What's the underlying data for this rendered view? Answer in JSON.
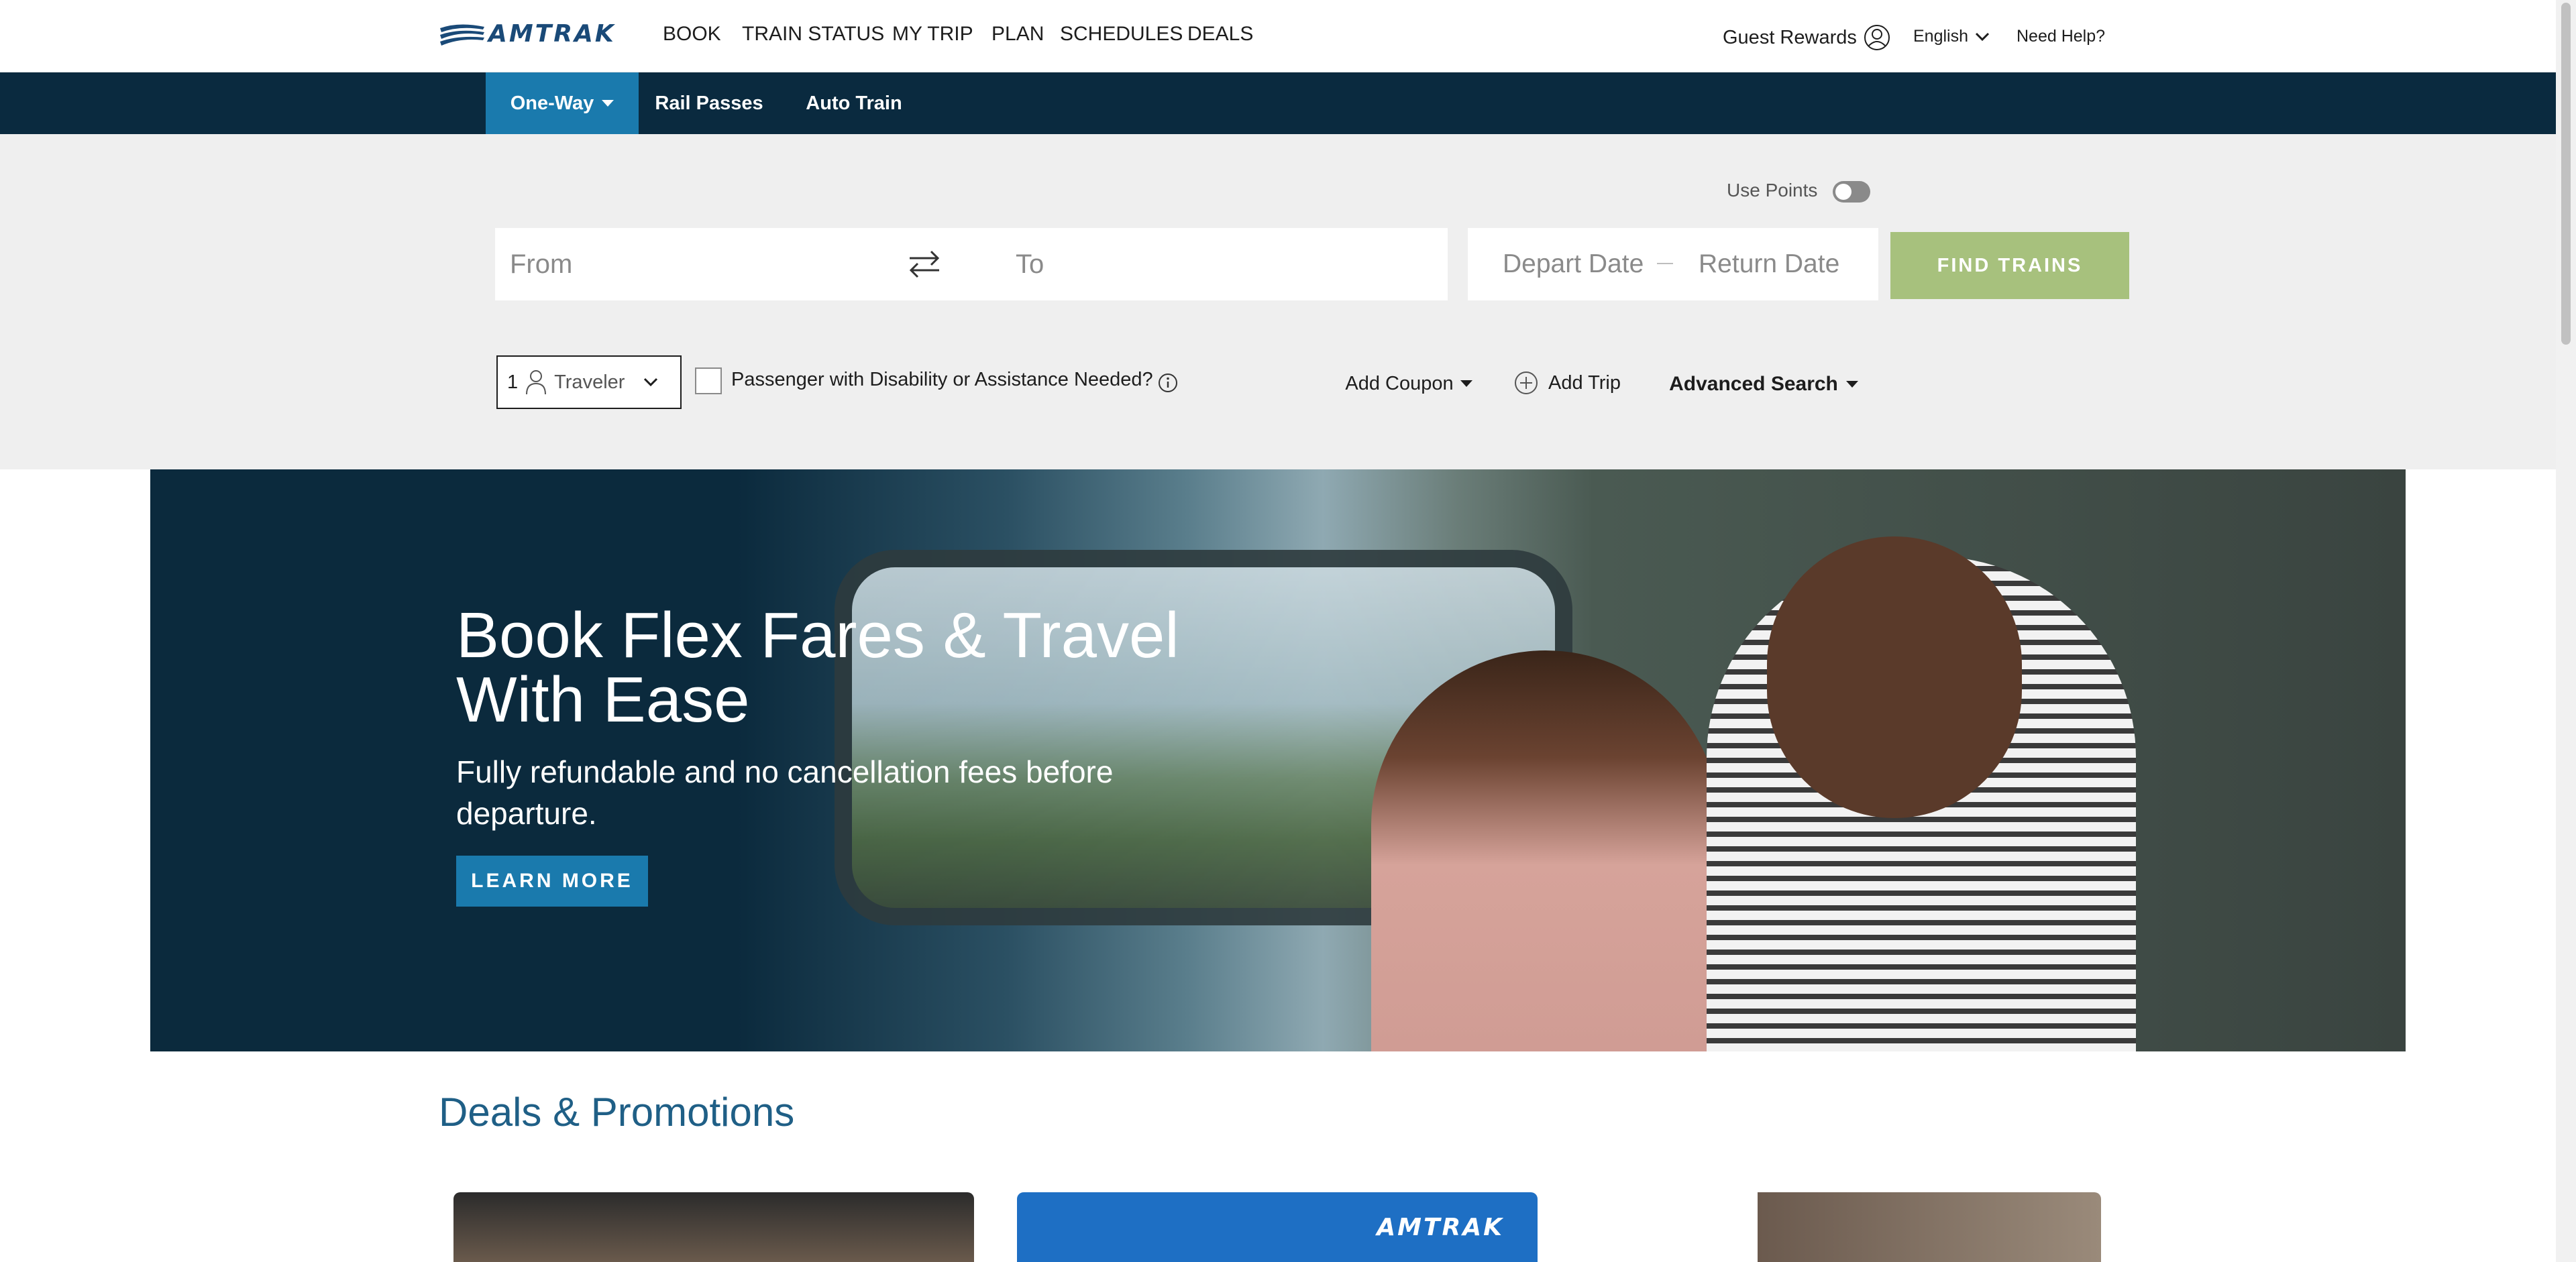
{
  "header": {
    "logo_text": "AMTRAK",
    "nav": [
      "BOOK",
      "TRAIN STATUS",
      "MY TRIP",
      "PLAN",
      "SCHEDULES",
      "DEALS"
    ],
    "guest_rewards": "Guest Rewards",
    "language": "English",
    "help": "Need Help?"
  },
  "booking": {
    "tabs": [
      "One-Way",
      "Rail Passes",
      "Auto Train"
    ],
    "use_points_label": "Use Points",
    "use_points_on": false,
    "from_placeholder": "From",
    "to_placeholder": "To",
    "depart_placeholder": "Depart Date",
    "return_placeholder": "Return Date",
    "find_trains": "FIND TRAINS",
    "traveler_count": "1",
    "traveler_label": "Traveler",
    "disability_label": "Passenger with Disability or Assistance Needed?",
    "coupon_label": "Add Coupon",
    "add_trip_label": "Add Trip",
    "advanced_search_label": "Advanced Search"
  },
  "hero": {
    "title": "Book Flex Fares & Travel With Ease",
    "subtitle": "Fully refundable and no cancellation fees before departure.",
    "cta": "LEARN MORE"
  },
  "deals": {
    "title": "Deals & Promotions",
    "card2_brand": "AMTRAK"
  },
  "colors": {
    "brand_blue": "#1a4a78",
    "tab_bar": "#0a2a3f",
    "active_tab": "#1a7aad",
    "find_button": "#a7c17d",
    "deals_title": "#1f5f86"
  }
}
